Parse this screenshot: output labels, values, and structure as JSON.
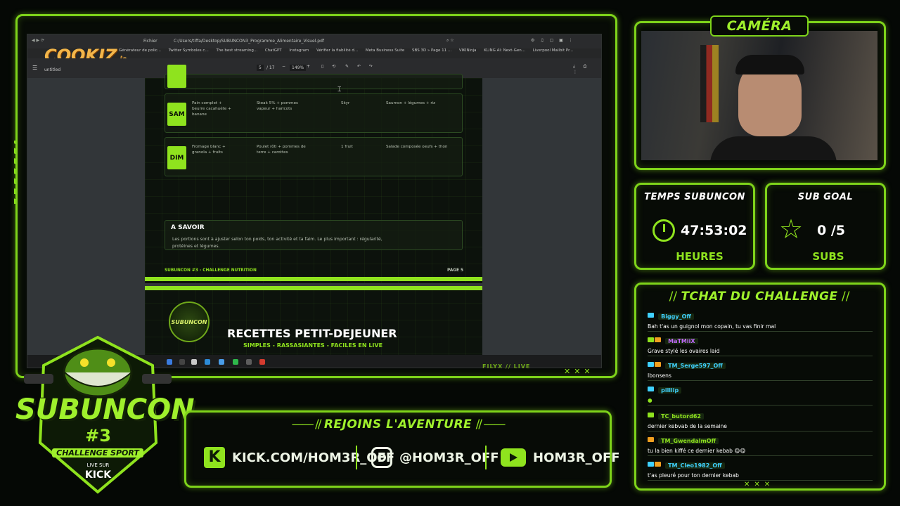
{
  "stream": {
    "brand_logo_text": "COOKIZ",
    "brand_logo_suffix": ".io",
    "watermark": "FILYX // LIVE",
    "main_logo": {
      "line1": "SUBUNCON",
      "line2": "#3",
      "line3": "CHALLENGE SPORT",
      "line4": "LIVE SUR",
      "line5": "KICK"
    }
  },
  "browser": {
    "path_label": "Fichier",
    "path": "C:/Users/tiffa/Desktop/SUBUNCON3_Programme_Alimentaire_Visuel.pdf",
    "bookmarks": [
      "Générateur de polic...",
      "Twitter Symboles c...",
      "The best streaming...",
      "ChatGPT",
      "Instagram",
      "Vérifier la fiabilité d...",
      "Meta Business Suite",
      "SBS 3D » Page 11 ...",
      "VIKINinja",
      "KLING AI: Next-Gen...",
      "Liverpool Mailbit Pr..."
    ],
    "doc_name": "untitled",
    "page_current": "5",
    "page_total": "/ 17",
    "zoom": "149%"
  },
  "pdf": {
    "rows": [
      {
        "day": "SAM",
        "breakfast": "Pain complet + beurre cacahuète + banane",
        "lunch": "Steak 5% + pommes vapeur + haricots",
        "snack": "Skyr",
        "dinner": "Saumon + légumes + riz"
      },
      {
        "day": "DIM",
        "breakfast": "Fromage blanc + granola + fruits",
        "lunch": "Poulet rôti + pommes de terre + carottes",
        "snack": "1 fruit",
        "dinner": "Salade composée oeufs + thon"
      }
    ],
    "info_title": "A SAVOIR",
    "info_text": "Les portions sont à ajuster selon ton poids, ton activité et ta faim. Le plus important : régularité, protéines et légumes.",
    "footer_left": "SUBUNCON #3 - CHALLENGE NUTRITION",
    "footer_right": "PAGE 5",
    "next_title": "RECETTES PETIT-DEJEUNER",
    "next_subtitle": "SIMPLES - RASSASIANTES - FACILES EN LIVE",
    "badge_text": "SUBUNCON"
  },
  "camera": {
    "title": "CAMÉRA"
  },
  "timer": {
    "title": "TEMPS SUBUNCON",
    "value": "47:53:02",
    "unit": "HEURES"
  },
  "subgoal": {
    "title": "SUB GOAL",
    "current": "0",
    "goal": "/5",
    "unit": "SUBS"
  },
  "chat": {
    "title": "TCHAT DU CHALLENGE",
    "messages": [
      {
        "user": "Biggy_Off",
        "color": "#3fd1ff",
        "text": "Bah t'as un guignol mon copain, tu vas finir mal"
      },
      {
        "user": "MaTMiiX",
        "color": "#c36bff",
        "text": "Grave stylé les ovaires laid"
      },
      {
        "user": "TM_Serge597_Off",
        "color": "#3fd1ff",
        "text": "Ibonsens"
      },
      {
        "user": "pilllip",
        "color": "#3fd1ff",
        "text": ""
      },
      {
        "user": "TC_butord62",
        "color": "#8fe31e",
        "text": "dernier kebvab de la semaine"
      },
      {
        "user": "TM_GwendalmOff",
        "color": "#8fe31e",
        "text": "tu la bien kiffé ce dernier kebab 😋😋"
      },
      {
        "user": "TM_Cleo1982_Off",
        "color": "#3fd1ff",
        "text": "t'as pleuré pour ton dernier kebab"
      }
    ]
  },
  "join": {
    "title": "REJOINS L'AVENTURE",
    "kick": "KICK.COM/HOM3R_OFF",
    "instagram": "@HOM3R_OFF",
    "youtube": "HOM3R_OFF"
  },
  "colors": {
    "accent": "#8fe31e",
    "background": "#050805"
  }
}
